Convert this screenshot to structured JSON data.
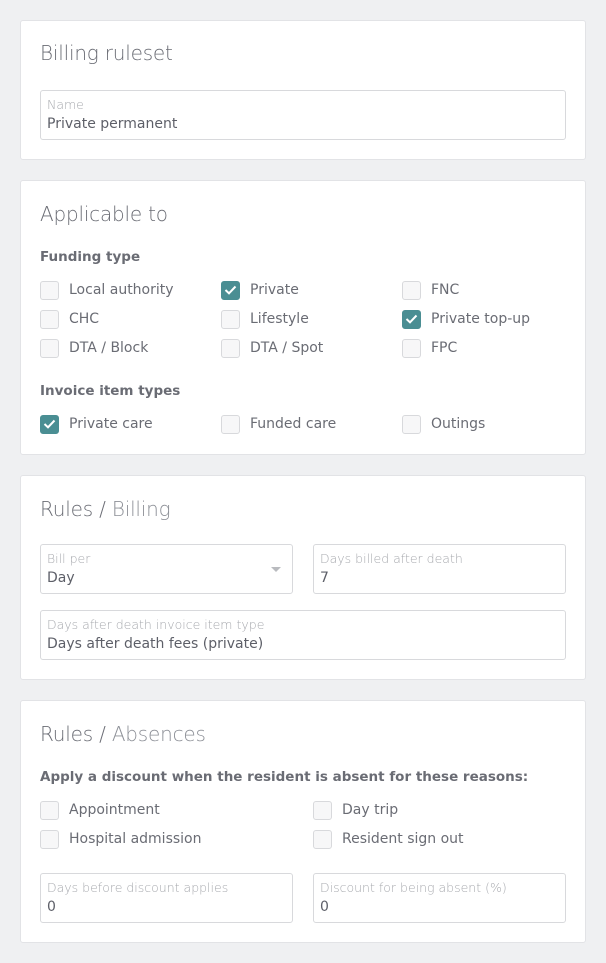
{
  "colors": {
    "accent": "#4a8e93",
    "background": "#eff0f2",
    "card": "#ffffff"
  },
  "billing_ruleset": {
    "title": "Billing ruleset",
    "name_field": {
      "label": "Name",
      "value": "Private permanent"
    }
  },
  "applicable_to": {
    "title": "Applicable to",
    "funding_type": {
      "label": "Funding type",
      "options": [
        {
          "label": "Local authority",
          "checked": false
        },
        {
          "label": "Private",
          "checked": true
        },
        {
          "label": "FNC",
          "checked": false
        },
        {
          "label": "CHC",
          "checked": false
        },
        {
          "label": "Lifestyle",
          "checked": false
        },
        {
          "label": "Private top-up",
          "checked": true
        },
        {
          "label": "DTA / Block",
          "checked": false
        },
        {
          "label": "DTA / Spot",
          "checked": false
        },
        {
          "label": "FPC",
          "checked": false
        }
      ]
    },
    "invoice_item_types": {
      "label": "Invoice item types",
      "options": [
        {
          "label": "Private care",
          "checked": true
        },
        {
          "label": "Funded care",
          "checked": false
        },
        {
          "label": "Outings",
          "checked": false
        }
      ]
    }
  },
  "rules_billing": {
    "title_main": "Rules",
    "title_sep": " / ",
    "title_sub": "Billing",
    "bill_per": {
      "label": "Bill per",
      "value": "Day"
    },
    "days_billed_after_death": {
      "label": "Days billed after death",
      "value": "7"
    },
    "days_after_death_item_type": {
      "label": "Days after death invoice item type",
      "value": "Days after death fees (private)"
    }
  },
  "rules_absences": {
    "title_main": "Rules",
    "title_sep": " / ",
    "title_sub": "Absences",
    "instruction": "Apply a discount when the resident is absent for these reasons:",
    "reasons": [
      {
        "label": "Appointment",
        "checked": false
      },
      {
        "label": "Day trip",
        "checked": false
      },
      {
        "label": "Hospital admission",
        "checked": false
      },
      {
        "label": "Resident sign out",
        "checked": false
      }
    ],
    "days_before_discount": {
      "label": "Days before discount applies",
      "value": "0"
    },
    "discount_percent": {
      "label": "Discount for being absent (%)",
      "value": "0"
    }
  }
}
